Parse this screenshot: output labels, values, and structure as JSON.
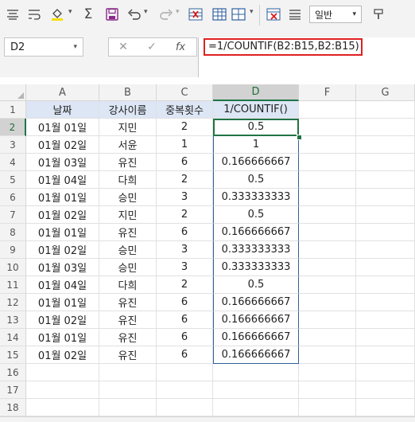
{
  "toolbar": {
    "number_format": "일반",
    "icons": [
      "align-icon",
      "wrap-icon",
      "fill-color-icon",
      "autosum-icon",
      "save-icon",
      "undo-icon",
      "redo-icon",
      "remove-dup-icon",
      "table-icon",
      "delete-icon",
      "list-icon"
    ]
  },
  "formula_bar": {
    "name_box": "D2",
    "cancel_glyph": "✕",
    "enter_glyph": "✓",
    "fx_glyph": "fx",
    "formula": "=1/COUNTIF(B2:B15,B2:B15)"
  },
  "grid": {
    "columns": [
      "A",
      "B",
      "C",
      "D",
      "F",
      "G"
    ],
    "header_row": [
      "날짜",
      "강사이름",
      "중복횟수",
      "1/COUNTIF()"
    ],
    "rows": [
      {
        "num": "1"
      },
      {
        "num": "2",
        "a": "01월 01일",
        "b": "지민",
        "c": "2",
        "d": "0.5"
      },
      {
        "num": "3",
        "a": "01월 02일",
        "b": "서윤",
        "c": "1",
        "d": "1"
      },
      {
        "num": "4",
        "a": "01월 03일",
        "b": "유진",
        "c": "6",
        "d": "0.166666667"
      },
      {
        "num": "5",
        "a": "01월 04일",
        "b": "다희",
        "c": "2",
        "d": "0.5"
      },
      {
        "num": "6",
        "a": "01월 01일",
        "b": "승민",
        "c": "3",
        "d": "0.333333333"
      },
      {
        "num": "7",
        "a": "01월 02일",
        "b": "지민",
        "c": "2",
        "d": "0.5"
      },
      {
        "num": "8",
        "a": "01월 01일",
        "b": "유진",
        "c": "6",
        "d": "0.166666667"
      },
      {
        "num": "9",
        "a": "01월 02일",
        "b": "승민",
        "c": "3",
        "d": "0.333333333"
      },
      {
        "num": "10",
        "a": "01월 03일",
        "b": "승민",
        "c": "3",
        "d": "0.333333333"
      },
      {
        "num": "11",
        "a": "01월 04일",
        "b": "다희",
        "c": "2",
        "d": "0.5"
      },
      {
        "num": "12",
        "a": "01월 01일",
        "b": "유진",
        "c": "6",
        "d": "0.166666667"
      },
      {
        "num": "13",
        "a": "01월 02일",
        "b": "유진",
        "c": "6",
        "d": "0.166666667"
      },
      {
        "num": "14",
        "a": "01월 01일",
        "b": "유진",
        "c": "6",
        "d": "0.166666667"
      },
      {
        "num": "15",
        "a": "01월 02일",
        "b": "유진",
        "c": "6",
        "d": "0.166666667"
      },
      {
        "num": "16"
      },
      {
        "num": "17"
      },
      {
        "num": "18"
      }
    ]
  },
  "colors": {
    "accent": "#217346",
    "highlight_border": "#e02020",
    "header_fill": "#dce6f4",
    "range_border": "#2f5f9e"
  }
}
